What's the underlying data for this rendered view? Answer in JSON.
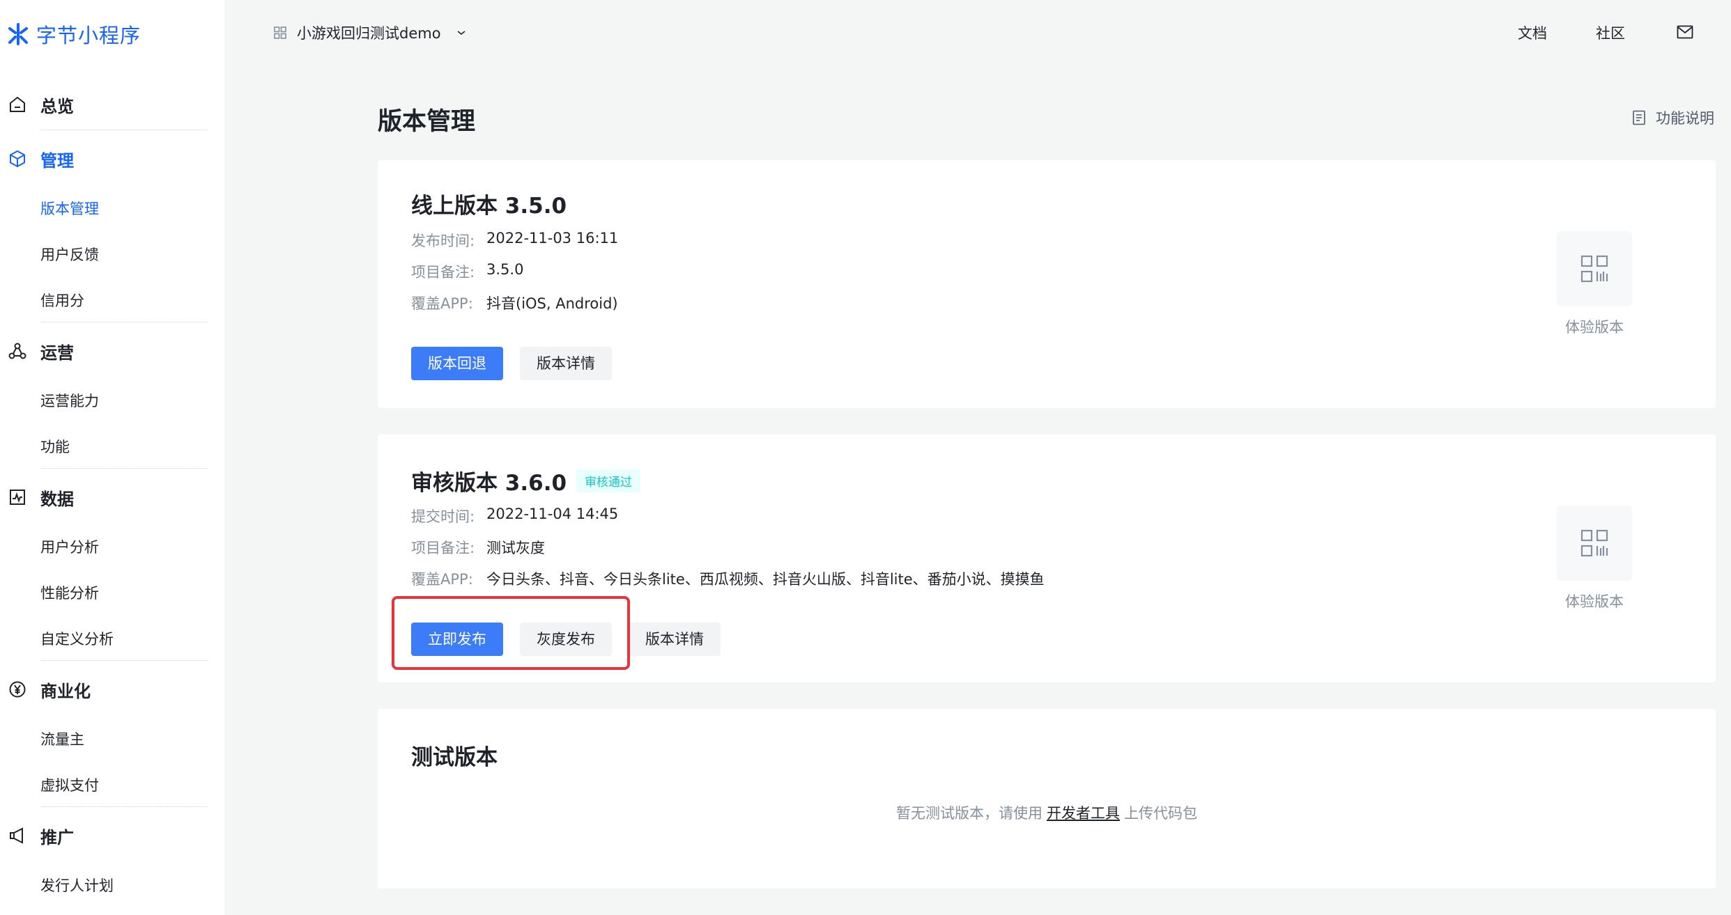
{
  "brand": {
    "logo_text": "字节小程序",
    "accent": "#1664ff"
  },
  "sidebar": {
    "groups": [
      {
        "label": "总览",
        "icon": "home-icon"
      },
      {
        "label": "管理",
        "icon": "cube-icon",
        "items": [
          "版本管理",
          "用户反馈",
          "信用分"
        ]
      },
      {
        "label": "运营",
        "icon": "share-icon",
        "items": [
          "运营能力",
          "功能"
        ]
      },
      {
        "label": "数据",
        "icon": "chart-icon",
        "items": [
          "用户分析",
          "性能分析",
          "自定义分析"
        ]
      },
      {
        "label": "商业化",
        "icon": "yen-icon",
        "items": [
          "流量主",
          "虚拟支付"
        ]
      },
      {
        "label": "推广",
        "icon": "megaphone-icon",
        "items": [
          "发行人计划"
        ]
      }
    ]
  },
  "header": {
    "project_name": "小游戏回归测试demo",
    "links": [
      "文档",
      "社区"
    ]
  },
  "page": {
    "title": "版本管理",
    "help_label": "功能说明"
  },
  "online_version": {
    "title": "线上版本 3.5.0",
    "rows": [
      {
        "label": "发布时间:",
        "value": "2022-11-03 16:11"
      },
      {
        "label": "项目备注:",
        "value": "3.5.0"
      },
      {
        "label": "覆盖APP:",
        "value": "抖音(iOS, Android)"
      }
    ],
    "buttons": [
      "版本回退",
      "版本详情"
    ],
    "qr_label": "体验版本"
  },
  "review_version": {
    "title": "审核版本 3.6.0",
    "status_badge": "审核通过",
    "rows": [
      {
        "label": "提交时间:",
        "value": "2022-11-04 14:45"
      },
      {
        "label": "项目备注:",
        "value": "测试灰度"
      },
      {
        "label": "覆盖APP:",
        "value": "今日头条、抖音、今日头条lite、西瓜视频、抖音火山版、抖音lite、番茄小说、摸摸鱼"
      }
    ],
    "buttons": [
      "立即发布",
      "灰度发布",
      "版本详情"
    ],
    "qr_label": "体验版本"
  },
  "test_version": {
    "title": "测试版本",
    "empty_prefix": "暂无测试版本，请使用",
    "empty_link": "开发者工具",
    "empty_suffix": "上传代码包"
  }
}
